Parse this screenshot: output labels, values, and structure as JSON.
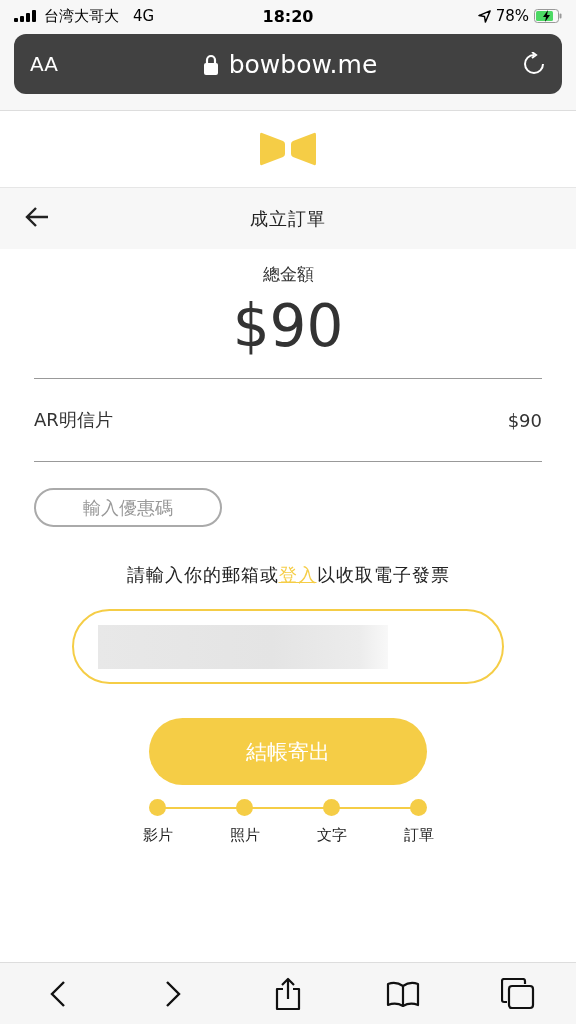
{
  "status_bar": {
    "carrier": "台湾大哥大",
    "network": "4G",
    "time": "18:20",
    "battery": "78%"
  },
  "address_bar": {
    "text_size": "AA",
    "url": "bowbow.me"
  },
  "header": {
    "title": "成立訂單"
  },
  "total": {
    "label": "總金額",
    "amount": "$90"
  },
  "items": [
    {
      "name": "AR明信片",
      "price": "$90"
    }
  ],
  "coupon_button": "輸入優惠碼",
  "email_prompt": {
    "before": "請輸入你的郵箱或",
    "link": "登入",
    "after": "以收取電子發票"
  },
  "email_field": {
    "redacted": true
  },
  "checkout_button": "結帳寄出",
  "steps": [
    {
      "label": "影片"
    },
    {
      "label": "照片"
    },
    {
      "label": "文字"
    },
    {
      "label": "訂單"
    }
  ]
}
